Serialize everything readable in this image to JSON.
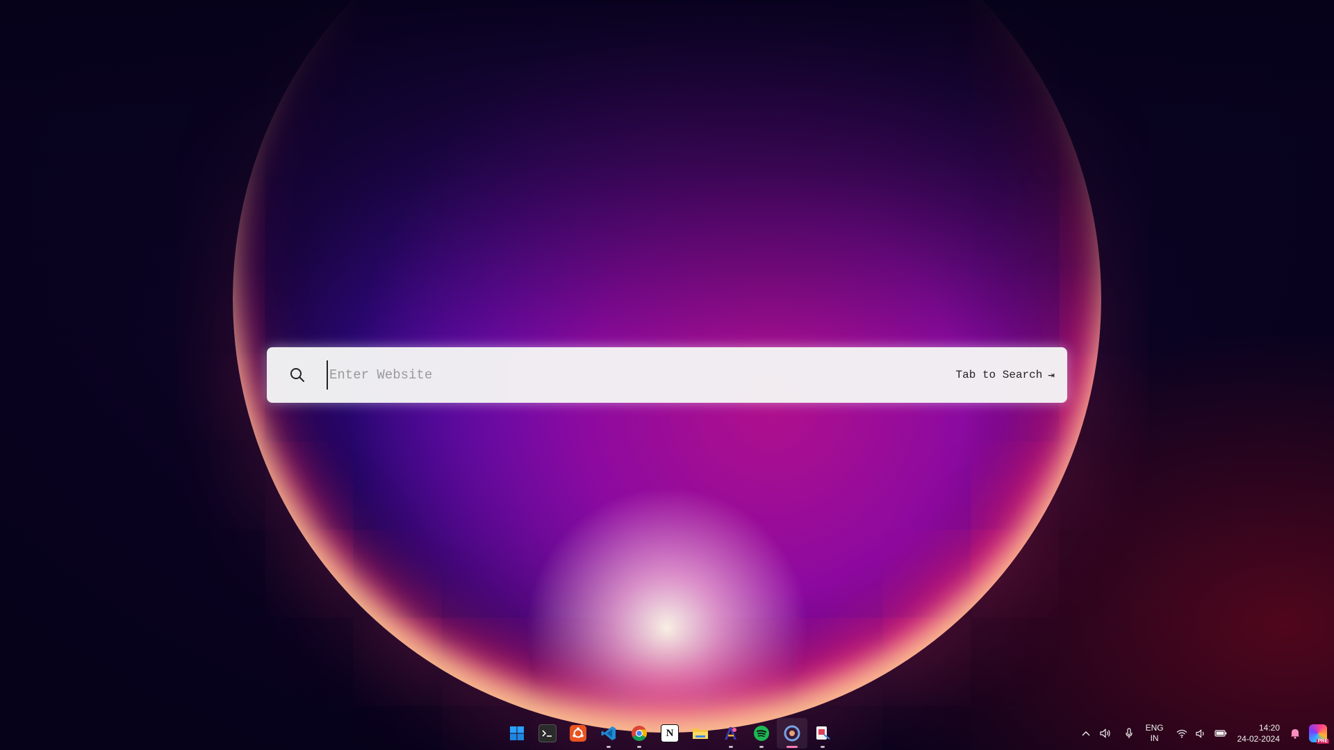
{
  "search": {
    "placeholder": "Enter Website",
    "value": "",
    "tab_hint": "Tab to Search",
    "tab_hint_icon": "tab-key-icon"
  },
  "taskbar": {
    "apps": [
      {
        "name": "start",
        "icon": "windows-logo-icon",
        "color": "#1e90ff",
        "running": false
      },
      {
        "name": "terminal",
        "icon": "terminal-icon",
        "color": "#2b2b2b",
        "running": false
      },
      {
        "name": "ubuntu",
        "icon": "ubuntu-icon",
        "color": "#e95420",
        "running": false
      },
      {
        "name": "vscode",
        "icon": "vscode-icon",
        "color": "#1f8ad2",
        "running": true
      },
      {
        "name": "chrome",
        "icon": "chrome-icon",
        "color": "#4285f4",
        "running": true
      },
      {
        "name": "notion",
        "icon": "notion-icon",
        "color": "#ffffff",
        "running": false
      },
      {
        "name": "file-explorer",
        "icon": "folder-icon",
        "color": "#f6c342",
        "running": false
      },
      {
        "name": "design-app",
        "icon": "design-app-icon",
        "color": "#3a3aa8",
        "running": true
      },
      {
        "name": "spotify",
        "icon": "spotify-icon",
        "color": "#1db954",
        "running": true
      },
      {
        "name": "browser-app",
        "icon": "browser-app-icon",
        "color": "#6b8fd6",
        "running": true,
        "active": true
      },
      {
        "name": "snipping-tool",
        "icon": "snipping-tool-icon",
        "color": "#e0405a",
        "running": true
      }
    ]
  },
  "tray": {
    "language_line1": "ENG",
    "language_line2": "IN",
    "time": "14:20",
    "date": "24-02-2024"
  }
}
